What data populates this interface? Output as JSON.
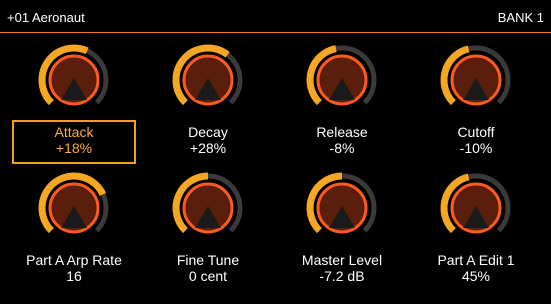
{
  "header": {
    "title": "+01 Aeronaut",
    "bank": "BANK 1"
  },
  "colors": {
    "accent": "#f5a623",
    "track": "#3a3a3a",
    "knob_ring": "#ff5a1f",
    "knob_fill": "#5a1f0c",
    "selected": "#f0a020"
  },
  "params": [
    {
      "label": "Attack",
      "value": "+18%",
      "level": 0.59,
      "selected": true
    },
    {
      "label": "Decay",
      "value": "+28%",
      "level": 0.64,
      "selected": false
    },
    {
      "label": "Release",
      "value": "-8%",
      "level": 0.46,
      "selected": false
    },
    {
      "label": "Cutoff",
      "value": "-10%",
      "level": 0.45,
      "selected": false
    },
    {
      "label": "Part A Arp Rate",
      "value": "16",
      "level": 0.74,
      "selected": false
    },
    {
      "label": "Fine Tune",
      "value": "0 cent",
      "level": 0.5,
      "selected": false
    },
    {
      "label": "Master Level",
      "value": "-7.2 dB",
      "level": 0.5,
      "selected": false
    },
    {
      "label": "Part A Edit 1",
      "value": "45%",
      "level": 0.45,
      "selected": false
    }
  ]
}
